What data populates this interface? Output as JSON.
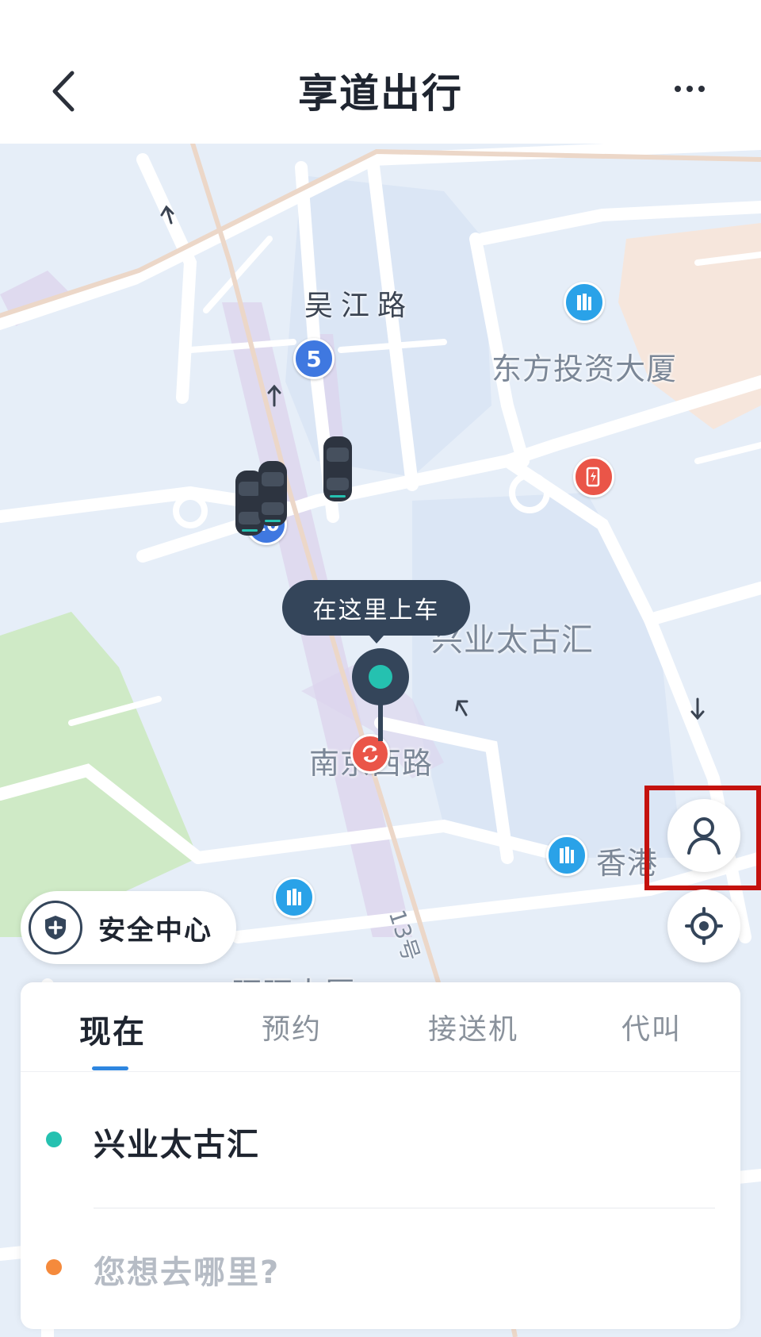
{
  "header": {
    "title": "享道出行"
  },
  "map": {
    "labels": {
      "wujiang_road": "吴江路",
      "dongfang_tower": "东方投资大厦",
      "xingye_taikoo": "兴业太古汇",
      "nanjing_west_road": "南京西路",
      "hongkong_partial": "香港",
      "wangwang_partial": "旺旺大厦",
      "road_number": "13号"
    },
    "metro_lines": {
      "line_a": "5",
      "line_b": "10"
    },
    "pickup_tooltip": "在这里上车"
  },
  "safety": {
    "label": "安全中心"
  },
  "tabs": [
    {
      "label": "现在",
      "active": true
    },
    {
      "label": "预约",
      "active": false
    },
    {
      "label": "接送机",
      "active": false
    },
    {
      "label": "代叫",
      "active": false
    }
  ],
  "trip": {
    "origin": "兴业太古汇",
    "destination_placeholder": "您想去哪里?"
  },
  "colors": {
    "pickup_accent": "#25C1B0",
    "destination_accent": "#F58A3C",
    "tab_indicator": "#2E86E0",
    "highlight_box": "#C4120E",
    "pin_dark": "#34455A"
  }
}
